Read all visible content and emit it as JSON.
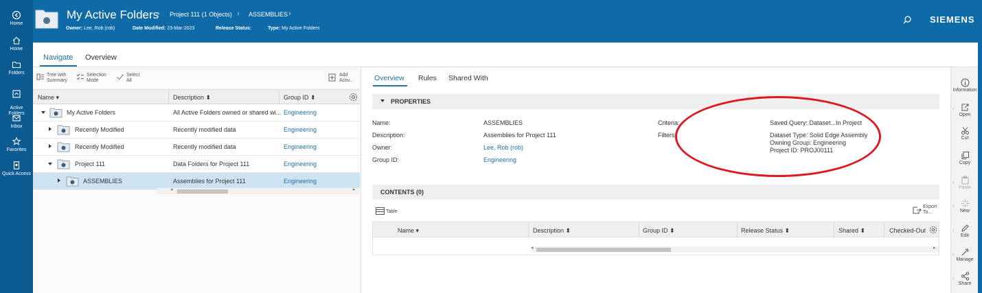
{
  "rail": {
    "items": [
      {
        "label": "Home"
      },
      {
        "label": "Home"
      },
      {
        "label": "Folders"
      },
      {
        "label": "Active\nFolders"
      },
      {
        "label": "Inbox"
      },
      {
        "label": "Favorites"
      },
      {
        "label": "Quick Access"
      }
    ]
  },
  "header": {
    "title": "My Active Folders",
    "breadcrumbs": [
      "Project 111 (1 Objects)",
      "ASSEMBLIES"
    ],
    "meta": {
      "owner_label": "Owner:",
      "owner_value": "Lee, Rob (rob)",
      "modified_label": "Date Modified:",
      "modified_value": "23-Mar-2023",
      "release_label": "Release Status:",
      "release_value": "",
      "type_label": "Type:",
      "type_value": "My Active Folders"
    },
    "brand": "SIEMENS"
  },
  "main_tabs": [
    {
      "label": "Navigate",
      "active": true
    },
    {
      "label": "Overview",
      "active": false
    }
  ],
  "left_toolbar": {
    "tree_with_summary": "Tree with\nSummary",
    "selection_mode": "Selection\nMode",
    "select_all": "Select\nAll",
    "add_active": "Add\nActiv..."
  },
  "tree": {
    "columns": [
      "Name",
      "Description",
      "Group ID"
    ],
    "rows": [
      {
        "name": "My Active Folders",
        "description": "All Active Folders owned or shared wi...",
        "group": "Engineering",
        "level": 0,
        "expanded": true,
        "selected": false
      },
      {
        "name": "Recently Modified",
        "description": "Recently modified data",
        "group": "Engineering",
        "level": 1,
        "expanded": false,
        "selected": false
      },
      {
        "name": "Recently Modified",
        "description": "Recently modified data",
        "group": "Engineering",
        "level": 1,
        "expanded": false,
        "selected": false
      },
      {
        "name": "Project 111",
        "description": "Data Folders for Project 111",
        "group": "Engineering",
        "level": 1,
        "expanded": true,
        "selected": false
      },
      {
        "name": "ASSEMBLIES",
        "description": "Assemblies for Project 111",
        "group": "Engineering",
        "level": 2,
        "expanded": false,
        "selected": true
      }
    ]
  },
  "sub_tabs": [
    {
      "label": "Overview",
      "active": true
    },
    {
      "label": "Rules",
      "active": false
    },
    {
      "label": "Shared With",
      "active": false
    }
  ],
  "properties": {
    "section_title": "PROPERTIES",
    "name_label": "Name:",
    "name_value": "ASSEMBLIES",
    "description_label": "Description:",
    "description_value": "Assemblies for Project 111",
    "owner_label": "Owner:",
    "owner_value": "Lee, Rob (rob)",
    "group_label": "Group ID:",
    "group_value": "Engineering",
    "criteria_label": "Criteria:",
    "criteria_value": "Saved Query: Dataset...In Project",
    "filters_label": "Filters:",
    "filters_values": [
      "Dataset Type: Solid Edge Assembly",
      "Owning Group: Engineering",
      "Project ID: PROJ00111"
    ]
  },
  "contents": {
    "section_title": "CONTENTS (0)",
    "view_label": "Table",
    "export_label": "Export\nTo...",
    "columns": [
      "Name",
      "Description",
      "Group ID",
      "Release Status",
      "Shared",
      "Checked-Out"
    ]
  },
  "right_toolbar": [
    {
      "label": "Information"
    },
    {
      "label": "Open"
    },
    {
      "label": "Cut"
    },
    {
      "label": "Copy"
    },
    {
      "label": "Paste"
    },
    {
      "label": "New"
    },
    {
      "label": "Edit"
    },
    {
      "label": "Manage"
    },
    {
      "label": "Share"
    }
  ],
  "colors": {
    "header_bg": "#0f6aa8",
    "rail_bg": "#0b5a92",
    "accent": "#1f6fa6",
    "selected_row": "#cde3f1",
    "annotation_ellipse": "#e0161e"
  }
}
